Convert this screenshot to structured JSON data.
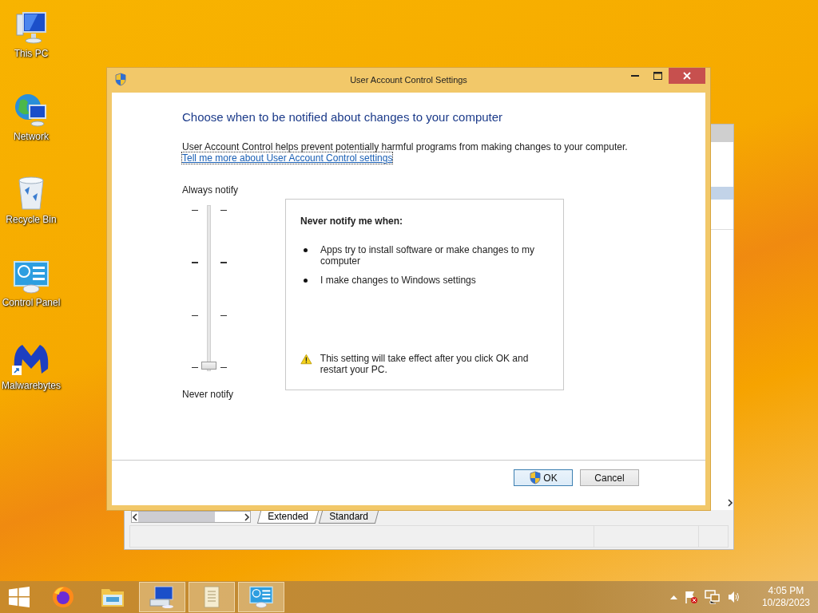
{
  "desktop_icons": [
    {
      "kind": "computer",
      "label": "This PC"
    },
    {
      "kind": "network",
      "label": "Network"
    },
    {
      "kind": "recycle",
      "label": "Recycle Bin"
    },
    {
      "kind": "control",
      "label": "Control Panel"
    },
    {
      "kind": "malware",
      "label": "Malwarebytes"
    }
  ],
  "background_window": {
    "tabs": [
      {
        "label": "Extended",
        "selected": true
      },
      {
        "label": "Standard",
        "selected": false
      }
    ]
  },
  "dialog": {
    "title": "User Account Control Settings",
    "heading": "Choose when to be notified about changes to your computer",
    "description": "User Account Control helps prevent potentially harmful programs from making changes to your computer.",
    "link": "Tell me more about User Account Control settings",
    "slider": {
      "top_label": "Always notify",
      "bottom_label": "Never notify",
      "level": 0
    },
    "info": {
      "title": "Never notify me when:",
      "bullets": [
        "Apps try to install software or make changes to my computer",
        "I make changes to Windows settings"
      ],
      "warning": "This setting will take effect after you click OK and restart your PC."
    },
    "buttons": [
      {
        "label": "OK",
        "kind": "shield",
        "default": true
      },
      {
        "label": "Cancel",
        "kind": "plain",
        "default": false
      }
    ]
  },
  "taskbar": {
    "apps": [
      {
        "kind": "firefox",
        "running": false
      },
      {
        "kind": "explorer",
        "running": false
      },
      {
        "kind": "keyboard",
        "running": true
      },
      {
        "kind": "scroll",
        "running": true
      },
      {
        "kind": "control",
        "running": true
      }
    ],
    "time": "4:05 PM",
    "date": "10/28/2023"
  }
}
